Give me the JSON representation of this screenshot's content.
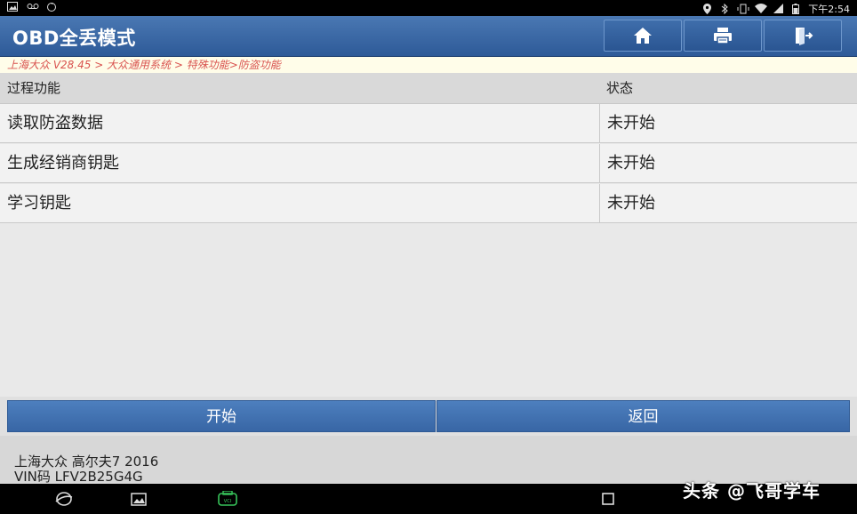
{
  "status_bar": {
    "time": "下午2:54",
    "left_icons": [
      "image-icon",
      "voicemail-icon",
      "sync-icon"
    ],
    "right_icons": [
      "location-icon",
      "bluetooth-icon",
      "vibrate-icon",
      "wifi-icon",
      "signal-icon",
      "battery-icon"
    ]
  },
  "header": {
    "title": "OBD全丢模式",
    "buttons": [
      "home-icon",
      "print-icon",
      "exit-icon"
    ]
  },
  "breadcrumb": "上海大众 V28.45 > 大众通用系统 > 特殊功能>防盗功能",
  "table": {
    "headers": [
      "过程功能",
      "状态"
    ],
    "rows": [
      {
        "function": "读取防盗数据",
        "status": "未开始"
      },
      {
        "function": "生成经销商钥匙",
        "status": "未开始"
      },
      {
        "function": "学习钥匙",
        "status": "未开始"
      }
    ]
  },
  "actions": {
    "start": "开始",
    "back": "返回"
  },
  "vehicle": {
    "model": "上海大众 高尔夫7 2016",
    "vin": "VIN码 LFV2B25G4G"
  },
  "watermark": "头条 @飞哥学车",
  "colors": {
    "header": "#2e5a98",
    "button": "#3866a5",
    "breadcrumb_text": "#d9534f"
  }
}
